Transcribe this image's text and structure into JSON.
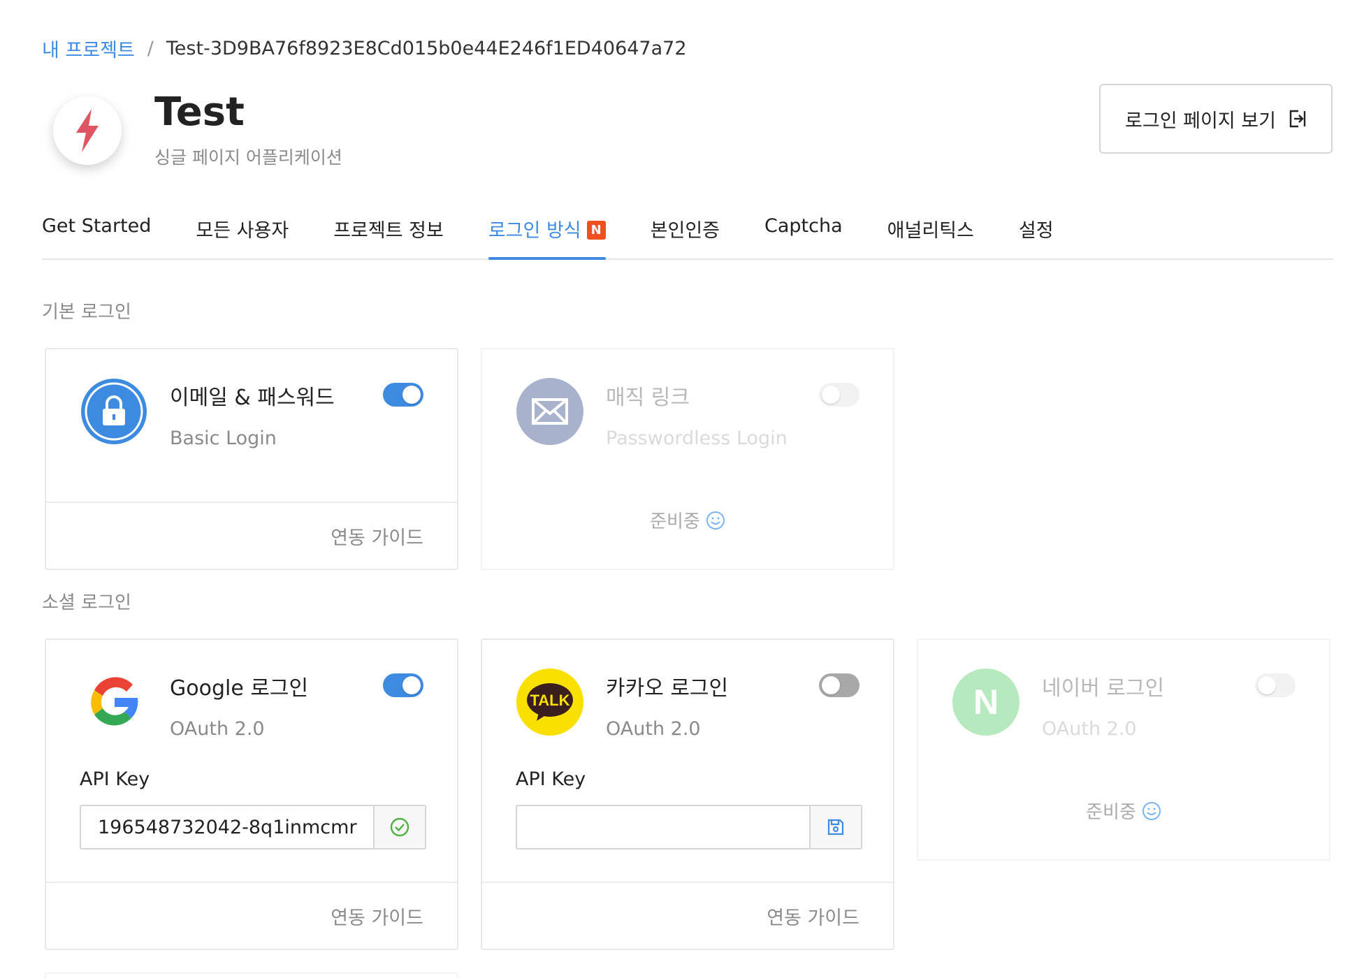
{
  "breadcrumb": {
    "root": "내 프로젝트",
    "separator": "/",
    "current": "Test-3D9BA76f8923E8Cd015b0e44E246f1ED40647a72"
  },
  "project": {
    "title": "Test",
    "subtitle": "싱글 페이지 어플리케이션",
    "logo_icon": "lightning-bolt-icon",
    "logo_color": "#e05562"
  },
  "header": {
    "login_page_button": "로그인 페이지 보기",
    "login_page_icon": "external-open-icon"
  },
  "tabs": [
    {
      "label": "Get Started",
      "active": false
    },
    {
      "label": "모든 사용자",
      "active": false
    },
    {
      "label": "프로젝트 정보",
      "active": false
    },
    {
      "label": "로그인 방식",
      "active": true,
      "badge": "N"
    },
    {
      "label": "본인인증",
      "active": false
    },
    {
      "label": "Captcha",
      "active": false
    },
    {
      "label": "애널리틱스",
      "active": false
    },
    {
      "label": "설정",
      "active": false
    }
  ],
  "sections": {
    "basic": "기본 로그인",
    "social": "소셜 로그인"
  },
  "cards": {
    "email": {
      "name": "이메일 & 패스워드",
      "sub": "Basic Login",
      "enabled": true,
      "guide": "연동 가이드",
      "icon": "lock-icon"
    },
    "magic": {
      "name": "매직 링크",
      "sub": "Passwordless Login",
      "enabled": false,
      "status": "준비중",
      "icon": "envelope-icon"
    },
    "google": {
      "name": "Google 로그인",
      "sub": "OAuth 2.0",
      "enabled": true,
      "api_label": "API Key",
      "api_value": "196548732042-8q1inmcmr",
      "guide": "연동 가이드",
      "icon": "google-g-icon",
      "action_icon": "check-circle-icon"
    },
    "kakao": {
      "name": "카카오 로그인",
      "sub": "OAuth 2.0",
      "enabled": false,
      "api_label": "API Key",
      "api_value": "",
      "guide": "연동 가이드",
      "icon": "kakao-talk-icon",
      "icon_text": "TALK",
      "action_icon": "save-icon"
    },
    "naver": {
      "name": "네이버 로그인",
      "sub": "OAuth 2.0",
      "enabled": false,
      "status": "준비중",
      "icon": "naver-n-icon",
      "icon_text": "N"
    }
  },
  "colors": {
    "accent": "#3d8be0",
    "badge": "#f0501e",
    "kakao_yellow": "#f9e000",
    "naver_green": "#b7e9bf",
    "check_green": "#52b043"
  }
}
